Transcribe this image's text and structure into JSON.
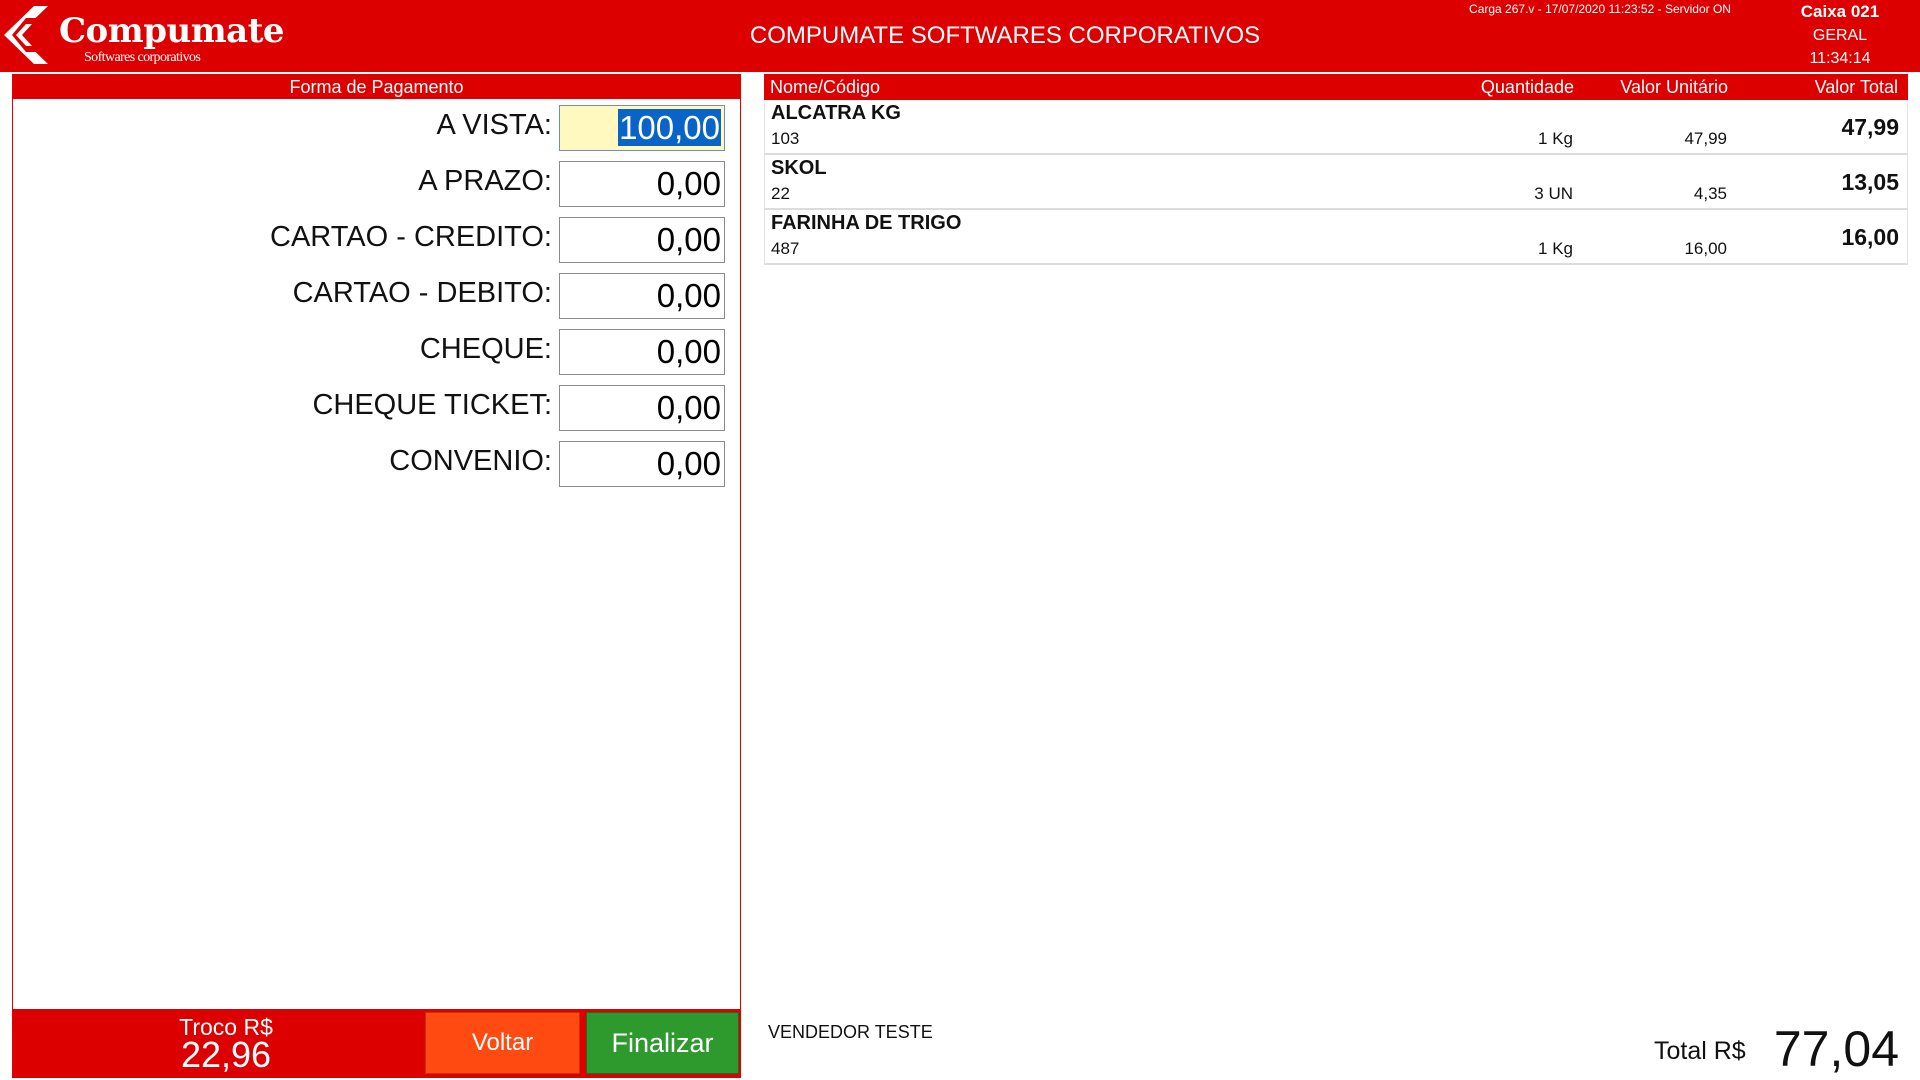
{
  "header": {
    "brand": "Compumate",
    "brand_sub": "Softwares corporativos",
    "title": "COMPUMATE SOFTWARES CORPORATIVOS",
    "status": "Carga 267.v - 17/07/2020 11:23:52 - Servidor ON",
    "caixa": "Caixa 021",
    "section": "GERAL",
    "clock": "11:34:14"
  },
  "payment": {
    "title": "Forma de Pagamento",
    "methods": [
      {
        "label": "A VISTA:",
        "value": "100,00"
      },
      {
        "label": "A PRAZO:",
        "value": "0,00"
      },
      {
        "label": "CARTAO - CREDITO:",
        "value": "0,00"
      },
      {
        "label": "CARTAO - DEBITO:",
        "value": "0,00"
      },
      {
        "label": "CHEQUE:",
        "value": "0,00"
      },
      {
        "label": "CHEQUE TICKET:",
        "value": "0,00"
      },
      {
        "label": "CONVENIO:",
        "value": "0,00"
      }
    ],
    "troco_label": "Troco R$",
    "troco_value": "22,96",
    "voltar_label": "Voltar",
    "finalizar_label": "Finalizar"
  },
  "items": {
    "columns": {
      "nome": "Nome/Código",
      "quantidade": "Quantidade",
      "valor_unitario": "Valor Unitário",
      "valor_total": "Valor Total"
    },
    "rows": [
      {
        "name": "ALCATRA KG",
        "code": "103",
        "qty": "1 Kg",
        "unit": "47,99",
        "total": "47,99"
      },
      {
        "name": "SKOL",
        "code": "22",
        "qty": "3 UN",
        "unit": "4,35",
        "total": "13,05"
      },
      {
        "name": "FARINHA DE TRIGO",
        "code": "487",
        "qty": "1 Kg",
        "unit": "16,00",
        "total": "16,00"
      }
    ]
  },
  "footer": {
    "vendedor": "VENDEDOR TESTE",
    "total_label": "Total R$",
    "total_value": "77,04"
  },
  "colors": {
    "brand_red": "#dd0000",
    "voltar_orange": "#ff4a12",
    "finalizar_green": "#2e9a2e",
    "active_field": "#fff9c0"
  }
}
